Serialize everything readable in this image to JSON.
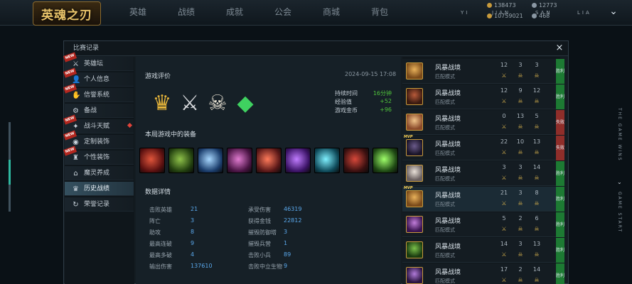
{
  "topbar": {
    "logo_text": "英魂之刃",
    "nav": [
      "英雄",
      "战绩",
      "成就",
      "公会",
      "商城",
      "背包"
    ],
    "users": [
      "YI",
      "JIAN",
      "SAN",
      "LIA"
    ],
    "currency": [
      "138473",
      "12773",
      "10759021",
      "468"
    ]
  },
  "side_text": [
    "THE GAME WINS",
    "GAME START"
  ],
  "dialog": {
    "title": "比赛记录",
    "close_icon": "×",
    "sidebar": [
      {
        "label": "英雄坛",
        "icon": "sword-icon",
        "glyph": "⚔",
        "new": true,
        "active": false
      },
      {
        "label": "个人信息",
        "icon": "person-icon",
        "glyph": "👤",
        "new": true,
        "active": false
      },
      {
        "label": "信誉系统",
        "icon": "handshake-icon",
        "glyph": "✋",
        "new": true,
        "active": false
      },
      {
        "label": "备战",
        "icon": "gear-icon",
        "glyph": "⚙",
        "new": false,
        "active": false
      },
      {
        "label": "战斗天赋",
        "icon": "flame-icon",
        "glyph": "✦",
        "new": true,
        "active": false,
        "dot": true
      },
      {
        "label": "定制装饰",
        "icon": "helmet-icon",
        "glyph": "◉",
        "new": true,
        "active": false
      },
      {
        "label": "个性装饰",
        "icon": "trophy-icon",
        "glyph": "♜",
        "new": true,
        "active": false
      },
      {
        "label": "魔灵养成",
        "icon": "temple-icon",
        "glyph": "⌂",
        "new": false,
        "active": false
      },
      {
        "label": "历史战绩",
        "icon": "trophy-cup-icon",
        "glyph": "♛",
        "new": false,
        "active": true
      },
      {
        "label": "荣誉记录",
        "icon": "cycle-icon",
        "glyph": "↻",
        "new": false,
        "active": false
      }
    ],
    "main": {
      "eval_title": "游戏评价",
      "date": "2024-09-15 17:08",
      "badges": [
        {
          "name": "crown-badge-icon",
          "glyph": "♛",
          "color": "#e5b43a"
        },
        {
          "name": "crossed-swords-badge-icon",
          "glyph": "⚔",
          "color": "#d7d9dc"
        },
        {
          "name": "skull-badge-icon",
          "glyph": "☠",
          "color": "#e8e2d3"
        },
        {
          "name": "emerald-badge-icon",
          "glyph": "◆",
          "color": "#3fd160"
        }
      ],
      "stats": [
        {
          "label": "持续时间",
          "value": "16分钟"
        },
        {
          "label": "经验值",
          "value": "+52"
        },
        {
          "label": "游戏金币",
          "value": "+96"
        }
      ],
      "equip_title": "本局游戏中的装备",
      "items": [
        {
          "name": "item-slot-1-icon",
          "c1": "#e0553b",
          "c2": "#5a1010"
        },
        {
          "name": "item-slot-2-icon",
          "c1": "#8fc24a",
          "c2": "#22400f"
        },
        {
          "name": "item-slot-3-icon",
          "c1": "#a8d8ff",
          "c2": "#1a3c6b"
        },
        {
          "name": "item-slot-4-icon",
          "c1": "#e07bd0",
          "c2": "#4a1444"
        },
        {
          "name": "item-slot-5-icon",
          "c1": "#ff7a5a",
          "c2": "#5a1818"
        },
        {
          "name": "item-slot-6-icon",
          "c1": "#c07cff",
          "c2": "#3b1366"
        },
        {
          "name": "item-slot-7-icon",
          "c1": "#7ff0ff",
          "c2": "#0f4a5a"
        },
        {
          "name": "item-slot-8-icon",
          "c1": "#d7483a",
          "c2": "#3a1010"
        },
        {
          "name": "item-slot-9-icon",
          "c1": "#9fff6a",
          "c2": "#1f4a14"
        }
      ],
      "details_title": "数据详情",
      "details_left": [
        {
          "label": "击败英雄",
          "value": "21"
        },
        {
          "label": "阵亡",
          "value": "3"
        },
        {
          "label": "助攻",
          "value": "8"
        },
        {
          "label": "最高连破",
          "value": "9"
        },
        {
          "label": "最高多破",
          "value": "4"
        },
        {
          "label": "输出伤害",
          "value": "137610"
        }
      ],
      "details_right": [
        {
          "label": "承受伤害",
          "value": "46319"
        },
        {
          "label": "获得金钱",
          "value": "22812"
        },
        {
          "label": "摧毁防御塔",
          "value": "3"
        },
        {
          "label": "摧毁兵营",
          "value": "1"
        },
        {
          "label": "击败小兵",
          "value": "89"
        },
        {
          "label": "击败中立生物",
          "value": "9"
        }
      ]
    },
    "matches": [
      {
        "mode": "风暴战境",
        "sub": "匹配模式",
        "k": "12",
        "d": "3",
        "a": "3",
        "result": "胜利",
        "win": true,
        "hero": [
          "#e8b15a",
          "#7a4a1a"
        ],
        "mvp": false,
        "active": false
      },
      {
        "mode": "风暴战境",
        "sub": "匹配模式",
        "k": "12",
        "d": "9",
        "a": "12",
        "result": "胜利",
        "win": true,
        "hero": [
          "#b85a3a",
          "#3a1a10"
        ],
        "mvp": false,
        "active": false
      },
      {
        "mode": "风暴战境",
        "sub": "匹配模式",
        "k": "0",
        "d": "13",
        "a": "5",
        "result": "失败",
        "win": false,
        "hero": [
          "#f0c48a",
          "#8a4a2a"
        ],
        "mvp": false,
        "active": false
      },
      {
        "mode": "风暴战境",
        "sub": "匹配模式",
        "k": "22",
        "d": "10",
        "a": "13",
        "result": "失败",
        "win": false,
        "hero": [
          "#6a5a8a",
          "#1a1428"
        ],
        "mvp": true,
        "active": false
      },
      {
        "mode": "风暴战境",
        "sub": "匹配模式",
        "k": "3",
        "d": "3",
        "a": "14",
        "result": "胜利",
        "win": true,
        "hero": [
          "#e8e0d8",
          "#6a6060"
        ],
        "mvp": false,
        "active": false
      },
      {
        "mode": "风暴战境",
        "sub": "匹配模式",
        "k": "21",
        "d": "3",
        "a": "8",
        "result": "胜利",
        "win": true,
        "hero": [
          "#e8b15a",
          "#7a4a1a"
        ],
        "mvp": true,
        "active": true
      },
      {
        "mode": "风暴战境",
        "sub": "匹配模式",
        "k": "5",
        "d": "2",
        "a": "6",
        "result": "胜利",
        "win": true,
        "hero": [
          "#c07cd8",
          "#3a1450"
        ],
        "mvp": false,
        "active": false
      },
      {
        "mode": "风暴战境",
        "sub": "匹配模式",
        "k": "14",
        "d": "3",
        "a": "13",
        "result": "胜利",
        "win": true,
        "hero": [
          "#7ac04a",
          "#1a3a10"
        ],
        "mvp": false,
        "active": false
      },
      {
        "mode": "风暴战境",
        "sub": "匹配模式",
        "k": "17",
        "d": "2",
        "a": "14",
        "result": "胜利",
        "win": true,
        "hero": [
          "#b07ad8",
          "#2a1440"
        ],
        "mvp": false,
        "active": false
      }
    ]
  }
}
